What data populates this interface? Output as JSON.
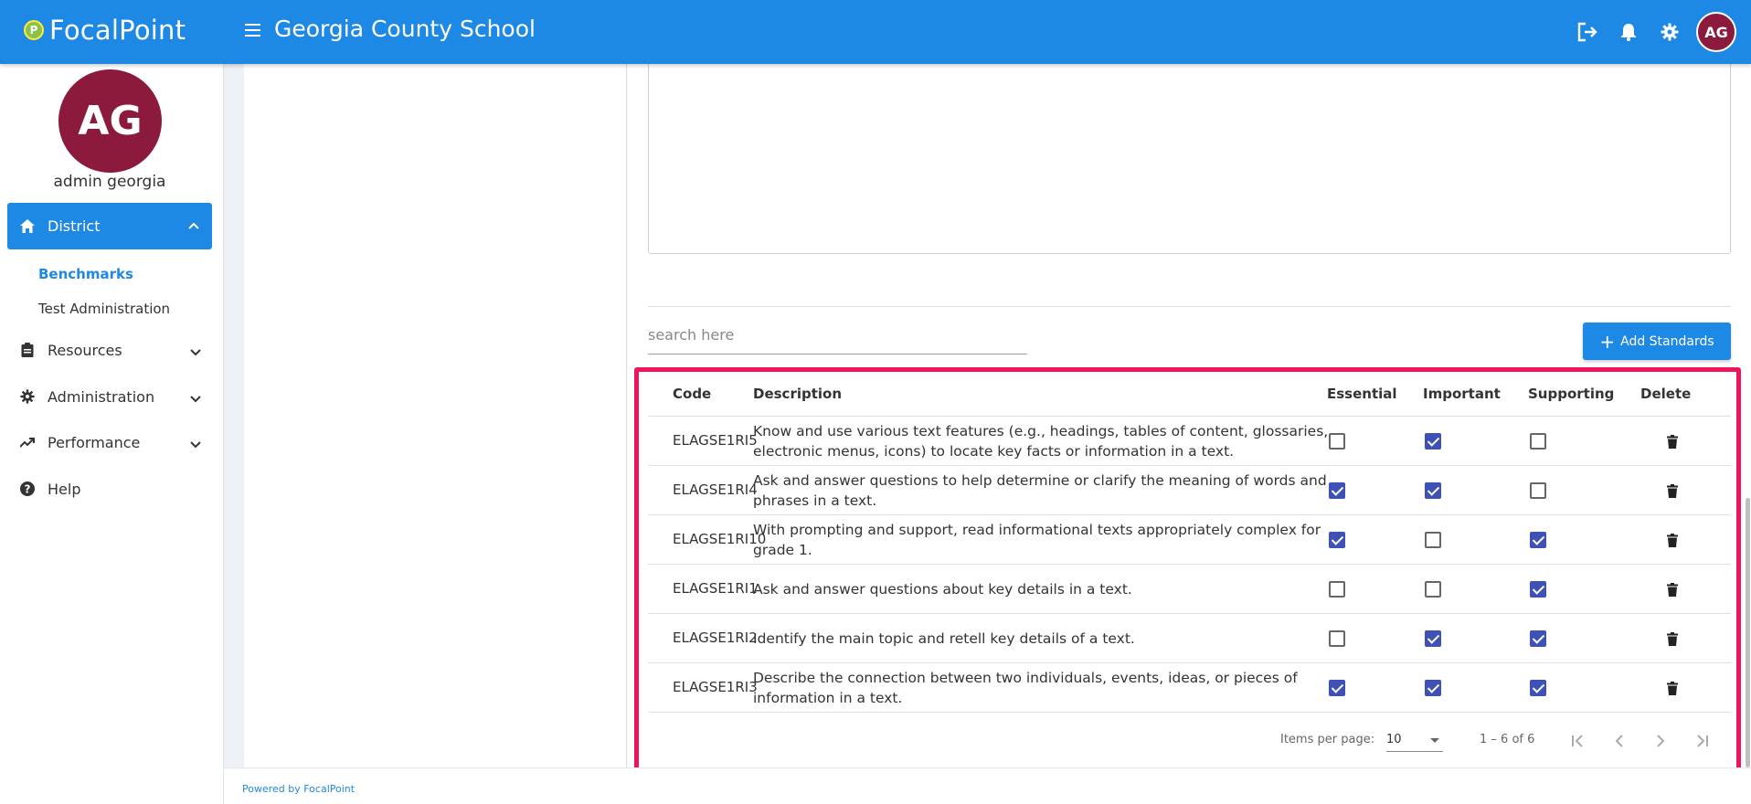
{
  "app": {
    "name": "FocalPoint",
    "logo_letter": "P",
    "school": "Georgia County School"
  },
  "user": {
    "initials": "AG",
    "name": "admin georgia"
  },
  "sidebar": {
    "active": {
      "label": "District"
    },
    "sub_items": [
      {
        "label": "Benchmarks",
        "active": true
      },
      {
        "label": "Test Administration",
        "active": false
      }
    ],
    "items": [
      {
        "label": "Resources"
      },
      {
        "label": "Administration"
      },
      {
        "label": "Performance"
      },
      {
        "label": "Help"
      }
    ]
  },
  "search": {
    "placeholder": "search here"
  },
  "add_button": {
    "label": "Add Standards"
  },
  "table": {
    "headers": {
      "code": "Code",
      "description": "Description",
      "essential": "Essential",
      "important": "Important",
      "supporting": "Supporting",
      "delete": "Delete"
    },
    "rows": [
      {
        "code": "ELAGSE1RI5",
        "description": "Know and use various text features (e.g., headings, tables of content, glossaries, electronic menus, icons) to locate key facts or information in a text.",
        "essential": false,
        "important": true,
        "supporting": false
      },
      {
        "code": "ELAGSE1RI4",
        "description": "Ask and answer questions to help determine or clarify the meaning of words and phrases in a text.",
        "essential": true,
        "important": true,
        "supporting": false
      },
      {
        "code": "ELAGSE1RI10",
        "description": "With prompting and support, read informational texts appropriately complex for grade 1.",
        "essential": true,
        "important": false,
        "supporting": true
      },
      {
        "code": "ELAGSE1RI1",
        "description": "Ask and answer questions about key details in a text.",
        "essential": false,
        "important": false,
        "supporting": true
      },
      {
        "code": "ELAGSE1RI2",
        "description": "Identify the main topic and retell key details of a text.",
        "essential": false,
        "important": true,
        "supporting": true
      },
      {
        "code": "ELAGSE1RI3",
        "description": "Describe the connection between two individuals, events, ideas, or pieces of information in a text.",
        "essential": true,
        "important": true,
        "supporting": true
      }
    ]
  },
  "paginator": {
    "items_per_page_label": "Items per page:",
    "items_per_page": "10",
    "range": "1 – 6 of 6"
  },
  "footer": {
    "powered_by": "Powered by FocalPoint"
  },
  "colors": {
    "primary": "#1e88e5",
    "avatar": "#8b1a3c",
    "checkbox": "#3f51b5",
    "highlight": "#f0145a"
  }
}
